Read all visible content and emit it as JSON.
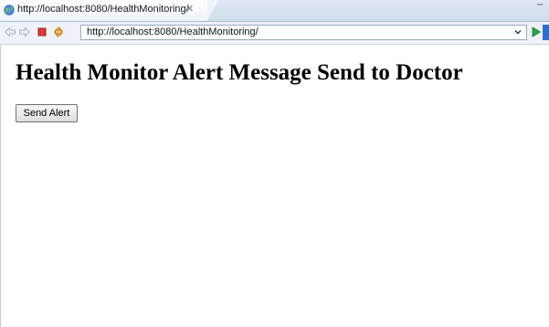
{
  "browser": {
    "tab_title": "http://localhost:8080/HealthMonitoring/",
    "tab_close_glyph": "✕",
    "window_minimize_glyph": "−",
    "address": "http://localhost:8080/HealthMonitoring/",
    "icons": {
      "tab": "globe-icon",
      "back": "back-arrow-icon",
      "forward": "forward-arrow-icon",
      "stop": "stop-icon",
      "refresh": "refresh-icon",
      "go": "go-arrow-icon",
      "address_dropdown": "chevron-down-icon"
    },
    "colors": {
      "stop": "#d83a3a",
      "refresh": "#f0a020",
      "go": "#2aa84a",
      "edge_button": "#2f6fd0"
    }
  },
  "page": {
    "title": "Health Monitor Alert Message Send to Doctor",
    "send_button_label": "Send Alert"
  }
}
